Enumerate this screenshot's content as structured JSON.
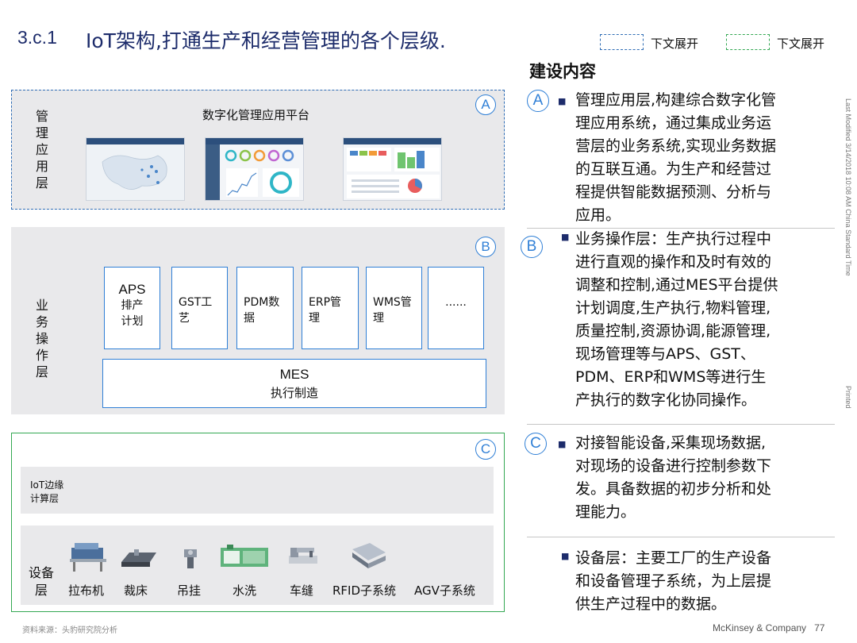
{
  "header": {
    "section_number": "3.c.1",
    "title": "IoT架构,打通生产和经营管理的各个层级."
  },
  "legend": [
    {
      "label": "下文展开",
      "color": "#2f6db5"
    },
    {
      "label": "下文展开",
      "color": "#34a853"
    }
  ],
  "panel_a": {
    "badge": "A",
    "layer_label": [
      "管",
      "理",
      "应",
      "用",
      "层"
    ],
    "platform_title": "数字化管理应用平台"
  },
  "panel_b": {
    "badge": "B",
    "layer_label": [
      "业",
      "务",
      "操",
      "作",
      "层"
    ],
    "modules": [
      {
        "line1": "APS",
        "line2": "排产",
        "line3": "计划"
      },
      {
        "line1": "GST工",
        "line2": "艺"
      },
      {
        "line1": "PDM数",
        "line2": "据"
      },
      {
        "line1": "ERP管",
        "line2": "理"
      },
      {
        "line1": "WMS管",
        "line2": "理"
      },
      {
        "line1": "......"
      }
    ],
    "mes_title": "MES",
    "mes_subtitle": "执行制造"
  },
  "panel_c": {
    "badge": "C",
    "edge_label_1": "IoT边缘",
    "edge_label_2": "计算层",
    "device_layer_label_1": "设备",
    "device_layer_label_2": "层",
    "devices": [
      "拉布机",
      "裁床",
      "吊挂",
      "水洗",
      "车缝",
      "RFID子系统",
      "AGV子系统"
    ]
  },
  "content": {
    "heading": "建设内容",
    "sections": [
      {
        "badge": "A",
        "lines": [
          "管理应用层,构建综合数字化管",
          "理应用系统，通过集成业务运",
          "营层的业务系统,实现业务数据",
          "的互联互通。为生产和经营过",
          "程提供智能数据预测、分析与",
          "应用。"
        ]
      },
      {
        "badge": "B",
        "lines": [
          "业务操作层：生产执行过程中",
          "进行直观的操作和及时有效的",
          "调整和控制,通过MES平台提供",
          "计划调度,生产执行,物料管理,",
          "质量控制,资源协调,能源管理,",
          "现场管理等与APS、GST、",
          "PDM、ERP和WMS等进行生",
          "产执行的数字化协同操作。"
        ]
      },
      {
        "badge": "C",
        "lines": [
          "对接智能设备,采集现场数据,",
          "对现场的设备进行控制参数下",
          "发。具备数据的初步分析和处",
          "理能力。"
        ]
      },
      {
        "badge": "",
        "lines": [
          "设备层：主要工厂的生产设备",
          "和设备管理子系统，为上层提",
          "供生产过程中的数据。"
        ]
      }
    ]
  },
  "sidebar": {
    "last_modified": "Last Modified 3/14/2018 10:08 AM China Standard Time",
    "printed": "Printed"
  },
  "footer": {
    "source": "资料来源：头豹研究院分析",
    "company": "McKinsey & Company",
    "page": "77"
  }
}
